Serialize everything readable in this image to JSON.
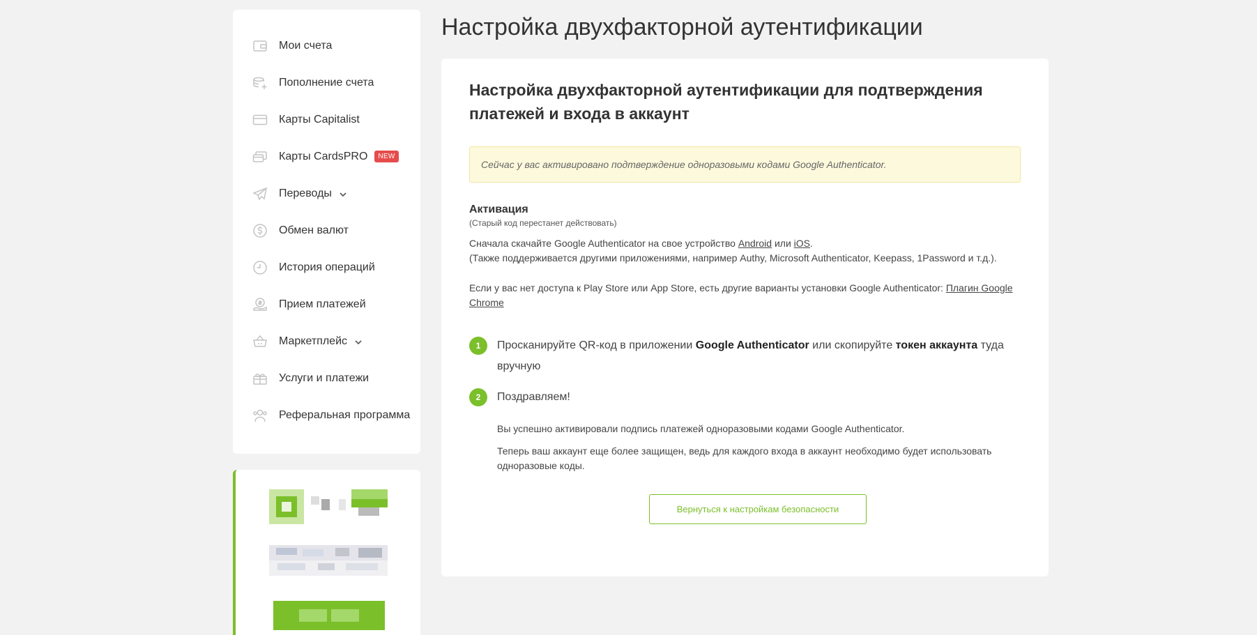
{
  "sidebar": {
    "items": [
      {
        "label": "Мои счета",
        "icon": "wallet-icon"
      },
      {
        "label": "Пополнение счета",
        "icon": "coins-add-icon"
      },
      {
        "label": "Карты Capitalist",
        "icon": "card-icon"
      },
      {
        "label": "Карты CardsPRO",
        "icon": "cards-stack-icon",
        "badge": "NEW"
      },
      {
        "label": "Переводы",
        "icon": "paper-plane-icon",
        "expandable": true
      },
      {
        "label": "Обмен валют",
        "icon": "currency-exchange-icon"
      },
      {
        "label": "История операций",
        "icon": "clock-icon"
      },
      {
        "label": "Прием платежей",
        "icon": "hand-coin-icon"
      },
      {
        "label": "Маркетплейс",
        "icon": "basket-icon",
        "expandable": true
      },
      {
        "label": "Услуги и платежи",
        "icon": "gift-icon"
      },
      {
        "label": "Реферальная программа",
        "icon": "users-icon"
      }
    ]
  },
  "page": {
    "title": "Настройка двухфакторной аутентификации"
  },
  "card": {
    "title": "Настройка двухфакторной аутентификации для подтверждения платежей и входа в аккаунт",
    "alert": "Сейчас у вас активировано подтверждение одноразовыми кодами Google Authenticator.",
    "activation_title": "Активация",
    "activation_sub": "(Старый код перестанет действовать)",
    "download_text": "Сначала скачайте Google Authenticator на свое устройство",
    "android_link": "Android",
    "or": "или",
    "ios_link": "iOS",
    "also_supported": "(Также поддерживается другими приложениями, например Authy, Microsoft Authenticator, Keepass, 1Password и т.д.).",
    "no_store_text": "Если у вас нет доступа к Play Store или App Store, есть другие варианты установки Google Authenticator:",
    "chrome_link": "Плагин Google Chrome",
    "step1_num": "1",
    "step1_a": "Просканируйте QR-код в приложении",
    "step1_b": "Google Authenticator",
    "step1_c": "или скопируйте",
    "step1_d": "токен аккаунта",
    "step1_e": "туда вручную",
    "step2_num": "2",
    "step2_title": "Поздравляем!",
    "success1": "Вы успешно активировали подпись платежей одноразовыми кодами Google Authenticator.",
    "success2": "Теперь ваш аккаунт еще более защищен, ведь для каждого входа в аккаунт необходимо будет использовать одноразовые коды.",
    "back_button": "Вернуться к настройкам безопасности"
  },
  "colors": {
    "accent": "#7bbf2a",
    "badge": "#e64c4c",
    "alert_bg": "#fdf9dc"
  }
}
